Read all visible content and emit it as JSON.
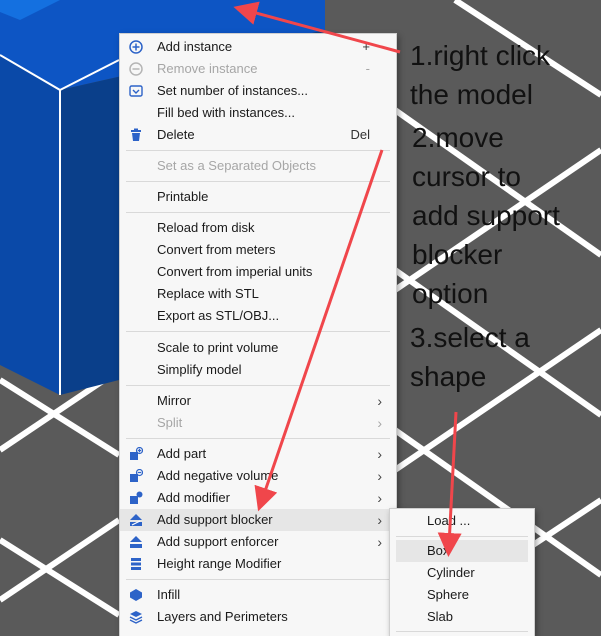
{
  "context_menu": {
    "items": [
      {
        "label": "Add instance",
        "shortcut": "+",
        "icon": "plus-circle-icon"
      },
      {
        "label": "Remove instance",
        "shortcut": "-",
        "icon": "minus-circle-icon",
        "disabled": true
      },
      {
        "label": "Set number of instances...",
        "icon": "instances-icon"
      },
      {
        "label": "Fill bed with instances..."
      },
      {
        "label": "Delete",
        "shortcut": "Del",
        "icon": "trash-icon"
      },
      {
        "label": "Set as a Separated Objects",
        "disabled": true
      },
      {
        "label": "Printable"
      },
      {
        "label": "Reload from disk"
      },
      {
        "label": "Convert from meters"
      },
      {
        "label": "Convert from imperial units"
      },
      {
        "label": "Replace with STL"
      },
      {
        "label": "Export as STL/OBJ..."
      },
      {
        "label": "Scale to print volume"
      },
      {
        "label": "Simplify model"
      },
      {
        "label": "Mirror",
        "submenu": true
      },
      {
        "label": "Split",
        "submenu": true,
        "disabled": true
      },
      {
        "label": "Add part",
        "submenu": true,
        "icon": "add-part-icon"
      },
      {
        "label": "Add negative volume",
        "submenu": true,
        "icon": "negative-volume-icon"
      },
      {
        "label": "Add modifier",
        "submenu": true,
        "icon": "modifier-icon"
      },
      {
        "label": "Add support blocker",
        "submenu": true,
        "icon": "support-blocker-icon",
        "highlighted": true
      },
      {
        "label": "Add support enforcer",
        "submenu": true,
        "icon": "support-enforcer-icon"
      },
      {
        "label": "Height range Modifier",
        "icon": "height-range-icon"
      },
      {
        "label": "Infill",
        "icon": "infill-icon"
      },
      {
        "label": "Layers and Perimeters",
        "icon": "layers-icon"
      }
    ]
  },
  "submenu": {
    "items": [
      {
        "label": "Load ..."
      },
      {
        "label": "Box",
        "highlighted": true
      },
      {
        "label": "Cylinder"
      },
      {
        "label": "Sphere"
      },
      {
        "label": "Slab"
      }
    ]
  },
  "annotations": {
    "step1": "1.right click\nthe model",
    "step2": "2.move\ncursor to\nadd support\nblocker\noption",
    "step3": "3.select a\nshape"
  },
  "colors": {
    "arrow": "#f0464b",
    "model_front": "#0a3f8a",
    "model_top": "#0d55c4",
    "bed": "#5a5a5a",
    "icon_blue": "#2d63c8"
  }
}
